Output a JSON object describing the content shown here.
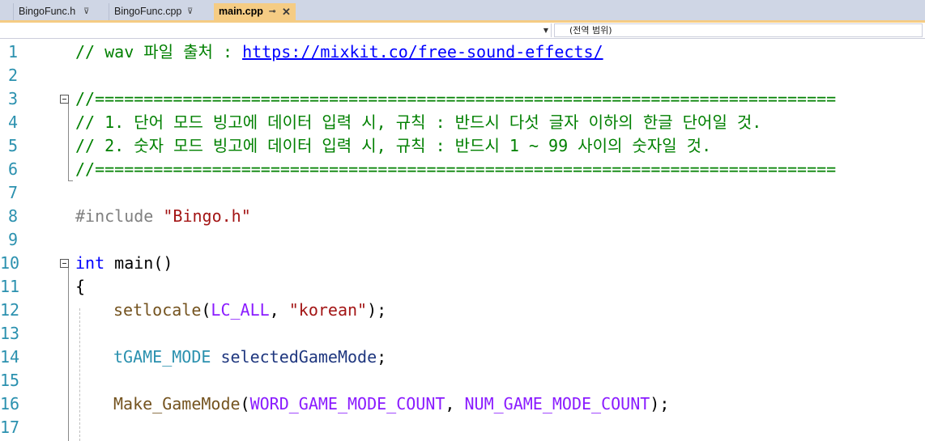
{
  "tabs": [
    {
      "label": "BingoFunc.h",
      "pin": "⊽"
    },
    {
      "label": "BingoFunc.cpp",
      "pin": "⊽"
    },
    {
      "label": "main.cpp",
      "pin": "⊸",
      "close": "✕"
    }
  ],
  "nav": {
    "left_scope": "",
    "right_scope": "(전역 범위)"
  },
  "editor": {
    "line_numbers": [
      "1",
      "2",
      "3",
      "4",
      "5",
      "6",
      "7",
      "8",
      "9",
      "10",
      "11",
      "12",
      "13",
      "14",
      "15",
      "16",
      "17"
    ],
    "lines": {
      "l1_comment": "// wav 파일 출처 : ",
      "l1_url": "https://mixkit.co/free-sound-effects/",
      "l3": "//============================================================================",
      "l4": "// 1. 단어 모드 빙고에 데이터 입력 시, 규칙 : 반드시 다섯 글자 이하의 한글 단어일 것.",
      "l5": "// 2. 숫자 모드 빙고에 데이터 입력 시, 규칙 : 반드시 1 ~ 99 사이의 숫자일 것.",
      "l6": "//============================================================================",
      "l8_directive": "#include ",
      "l8_path": "\"Bingo.h\"",
      "l10_kw": "int",
      "l10_rest": " main()",
      "l11": "{",
      "l12_fn": "setlocale",
      "l12_open": "(",
      "l12_macro": "LC_ALL",
      "l12_comma": ", ",
      "l12_str": "\"korean\"",
      "l12_close": ");",
      "l14_type": "tGAME_MODE",
      "l14_var": " selectedGameMode",
      "l14_end": ";",
      "l16_fn": "Make_GameMode",
      "l16_open": "(",
      "l16_m1": "WORD_GAME_MODE_COUNT",
      "l16_comma": ", ",
      "l16_m2": "NUM_GAME_MODE_COUNT",
      "l16_close": ");"
    }
  }
}
